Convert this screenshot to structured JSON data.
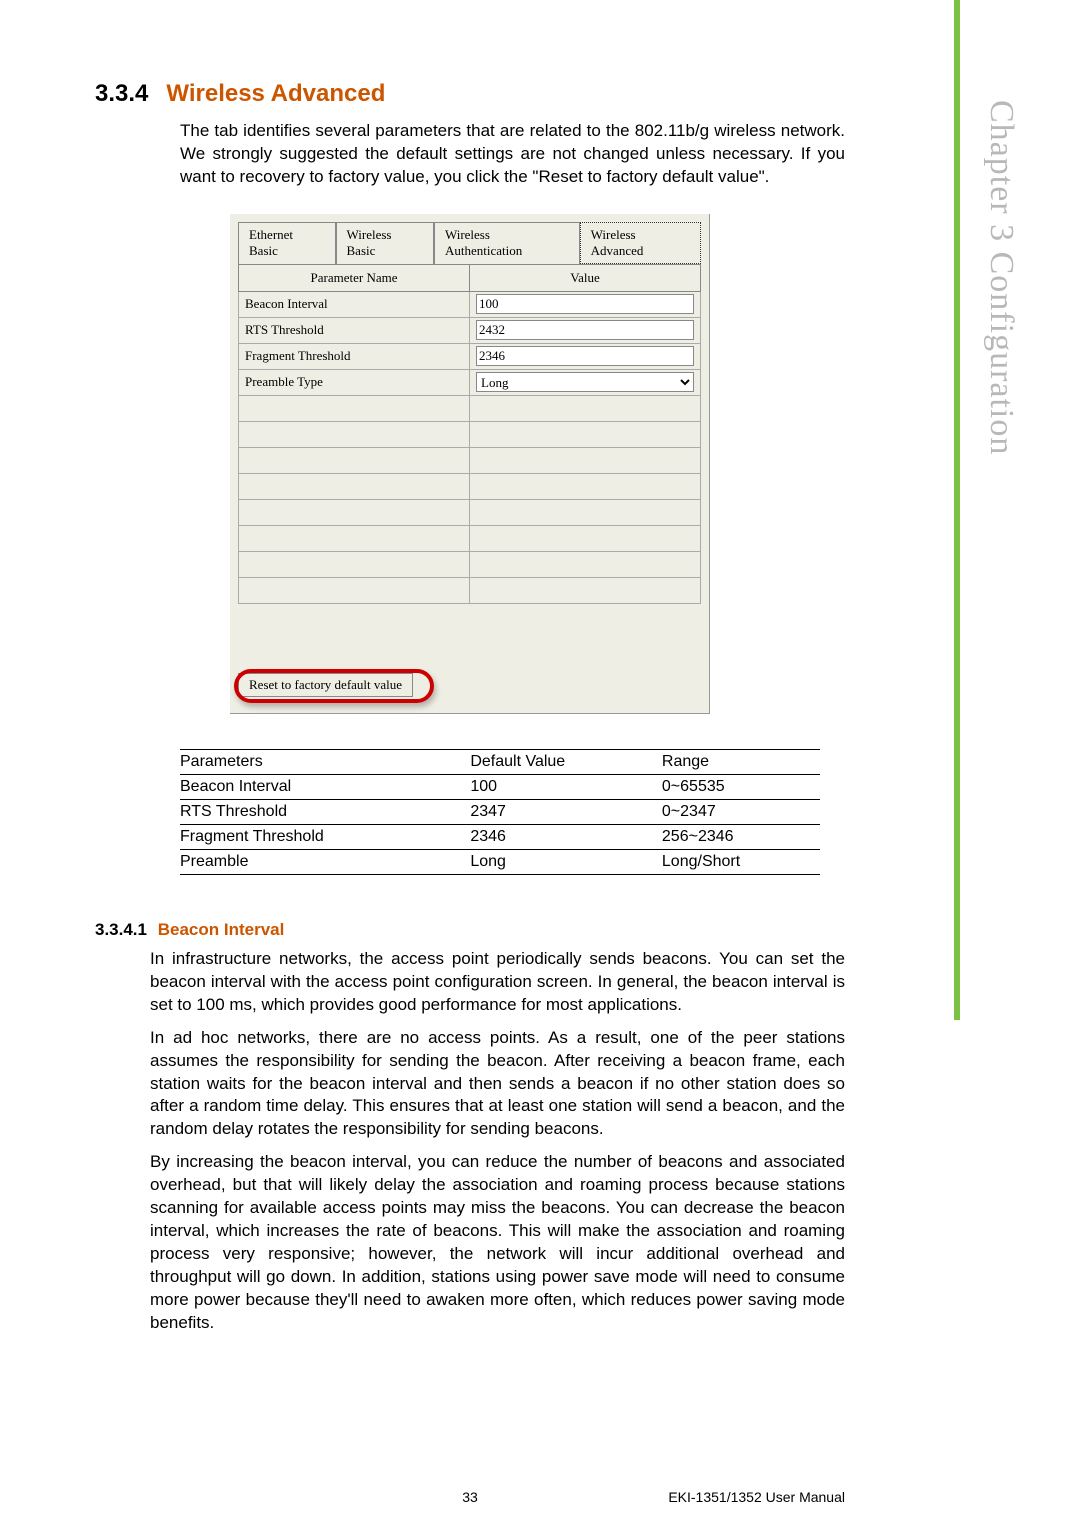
{
  "sideLabel": "Chapter 3   Configuration",
  "section": {
    "number": "3.3.4",
    "title": "Wireless Advanced",
    "intro": "The tab identifies several parameters that are related to the 802.11b/g wireless network. We strongly suggested the default settings are not changed unless necessary. If you want to recovery to factory value, you click the \"Reset to factory default value\"."
  },
  "tabs": [
    "Ethernet Basic",
    "Wireless Basic",
    "Wireless Authentication",
    "Wireless Advanced"
  ],
  "formHeaders": {
    "col1": "Parameter Name",
    "col2": "Value"
  },
  "formRows": [
    {
      "label": "Beacon Interval",
      "value": "100",
      "type": "text"
    },
    {
      "label": "RTS Threshold",
      "value": "2432",
      "type": "text"
    },
    {
      "label": "Fragment Threshold",
      "value": "2346",
      "type": "text"
    },
    {
      "label": "Preamble Type",
      "value": "Long",
      "type": "select"
    }
  ],
  "resetButton": "Reset to factory default value",
  "refTable": {
    "headers": [
      "Parameters",
      "Default Value",
      "Range"
    ],
    "rows": [
      [
        "Beacon Interval",
        "100",
        "0~65535"
      ],
      [
        "RTS Threshold",
        "2347",
        "0~2347"
      ],
      [
        "Fragment Threshold",
        "2346",
        "256~2346"
      ],
      [
        "Preamble",
        "Long",
        "Long/Short"
      ]
    ]
  },
  "subsection": {
    "number": "3.3.4.1",
    "title": "Beacon Interval",
    "p1": "In infrastructure networks, the access point periodically sends beacons. You can set the beacon interval with the access point configuration screen. In general, the beacon interval is set to 100 ms, which provides good performance for most applications.",
    "p2": "In ad hoc networks, there are no access points. As a result, one of the peer stations assumes the responsibility for sending the beacon. After receiving a beacon frame, each station waits for the beacon interval and then sends a beacon if no other station does so after a random time delay. This ensures that at least one station will send a beacon, and the random delay rotates the responsibility for sending beacons.",
    "p3": "By increasing the beacon interval, you can reduce the number of beacons and associated overhead, but that will likely delay the association and roaming process because stations scanning for available access points may miss the beacons. You can decrease the beacon interval, which increases the rate of beacons. This will make the association and roaming process very responsive; however, the network will incur additional overhead and throughput will go down. In addition, stations using power save mode will need to consume more power because they'll need to awaken more often, which reduces power saving mode benefits."
  },
  "footer": {
    "page": "33",
    "manual": "EKI-1351/1352 User Manual"
  }
}
